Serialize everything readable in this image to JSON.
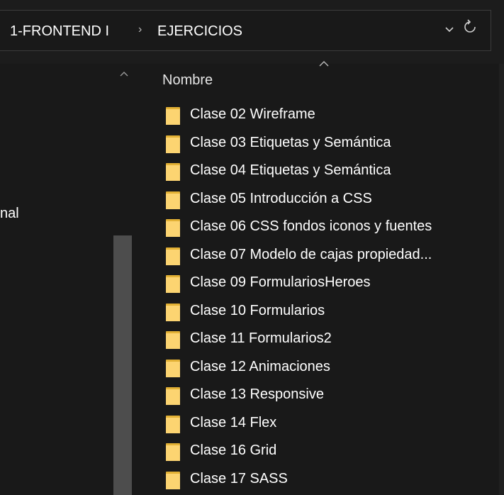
{
  "breadcrumb": {
    "items": [
      "1-FRONTEND I",
      "EJERCICIOS"
    ],
    "separator": "›"
  },
  "icons": {
    "dropdown": "chevron-down-icon",
    "refresh": "refresh-icon",
    "folder": "folder-icon"
  },
  "nav": {
    "partial_label": "nal"
  },
  "list": {
    "column_header": "Nombre",
    "items": [
      "Clase 02 Wireframe",
      "Clase 03 Etiquetas y Semántica",
      "Clase 04 Etiquetas y Semántica",
      "Clase 05 Introducción a CSS",
      "Clase 06 CSS fondos iconos y fuentes",
      "Clase 07 Modelo de cajas propiedad...",
      "Clase 09 FormulariosHeroes",
      "Clase 10 Formularios",
      "Clase 11 Formularios2",
      "Clase 12 Animaciones",
      "Clase 13 Responsive",
      "Clase 14 Flex",
      "Clase 16 Grid",
      "Clase 17 SASS"
    ]
  },
  "colors": {
    "background": "#191919",
    "folder": "#fcd471",
    "text": "#ffffff"
  }
}
